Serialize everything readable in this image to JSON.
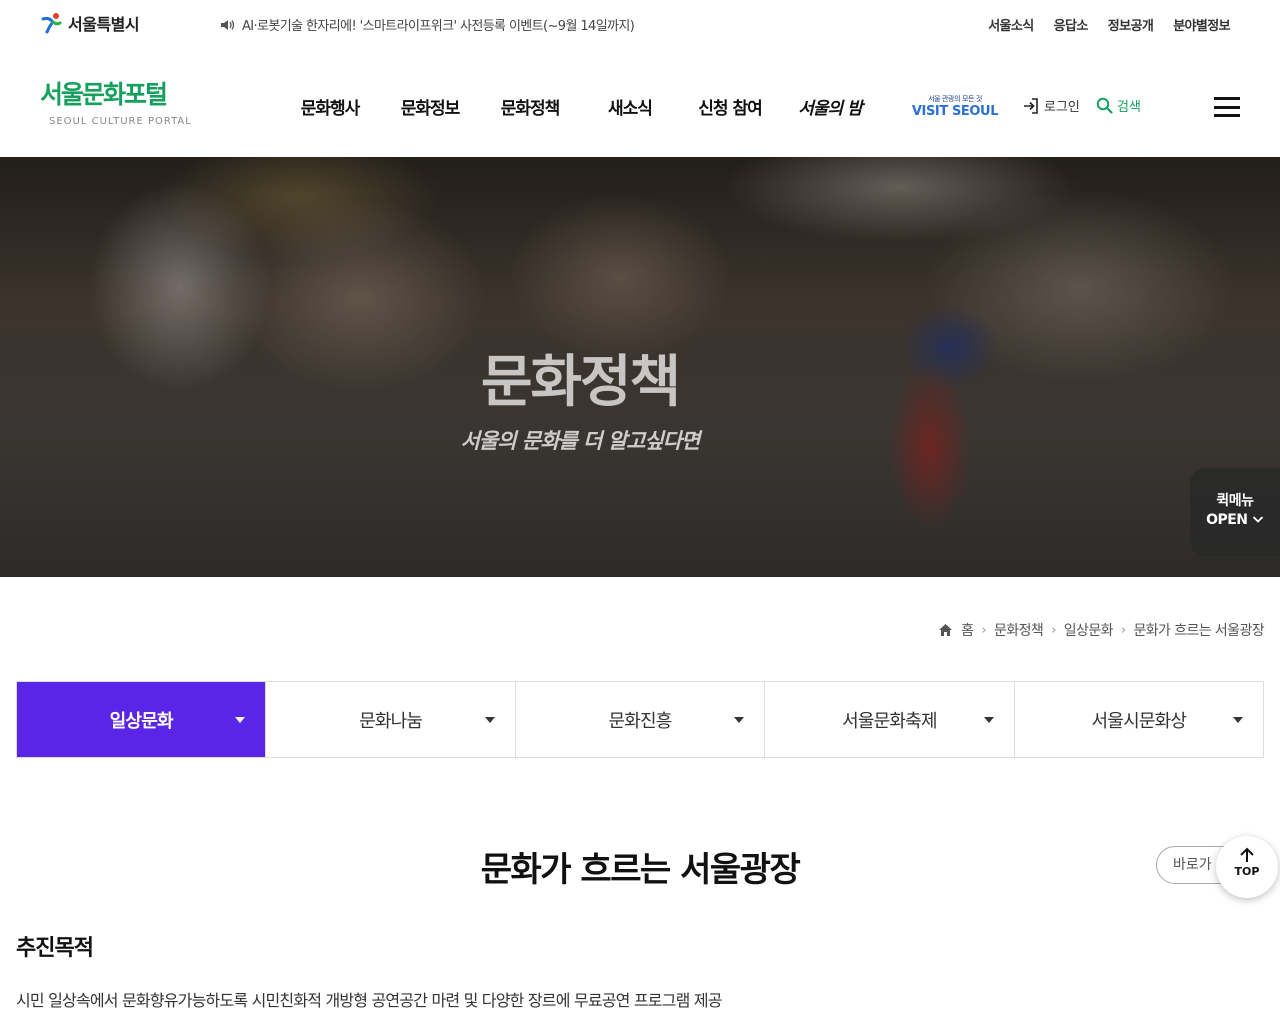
{
  "utility": {
    "seoul_logo": "서울특별시",
    "notice": "AI·로봇기술 한자리에! '스마트라이프위크' 사전등록 이벤트(~9월 14일까지)",
    "links": [
      "서울소식",
      "응답소",
      "정보공개",
      "분야별정보"
    ]
  },
  "header": {
    "logo_kr": "서울문화포털",
    "logo_en": "SEOUL CULTURE PORTAL",
    "nav": [
      "문화행사",
      "문화정보",
      "문화정책",
      "새소식",
      "신청 참여",
      "서울의 밤"
    ],
    "visit_sub": "서울 관광의 모든 것",
    "visit_main": "VISIT SEOUL",
    "login": "로그인",
    "search": "검색"
  },
  "hero": {
    "title": "문화정책",
    "subtitle": "서울의 문화를 더 알고싶다면",
    "quick_line1": "퀵메뉴",
    "quick_line2": "OPEN"
  },
  "breadcrumb": [
    "홈",
    "문화정책",
    "일상문화",
    "문화가 흐르는 서울광장"
  ],
  "subtabs": [
    "일상문화",
    "문화나눔",
    "문화진흥",
    "서울문화축제",
    "서울시문화상"
  ],
  "active_subtab": "일상문화",
  "content": {
    "page_title": "문화가 흐르는 서울광장",
    "shortcut_label": "바로가",
    "top_label": "TOP",
    "section_heading": "추진목적",
    "section_text": "시민 일상속에서 문화향유가능하도록 시민친화적 개방형 공연공간 마련 및 다양한 장르에 무료공연 프로그램 제공"
  },
  "colors": {
    "brand_green": "#16a05e",
    "active_tab": "#5a25e6",
    "visit_blue": "#2a6fd6"
  },
  "icons": [
    "seoul-symbol-icon",
    "speaker-icon",
    "login-icon",
    "search-icon",
    "hamburger-icon",
    "chevron-down-icon",
    "home-icon",
    "chevron-right-icon",
    "arrow-up-icon"
  ]
}
